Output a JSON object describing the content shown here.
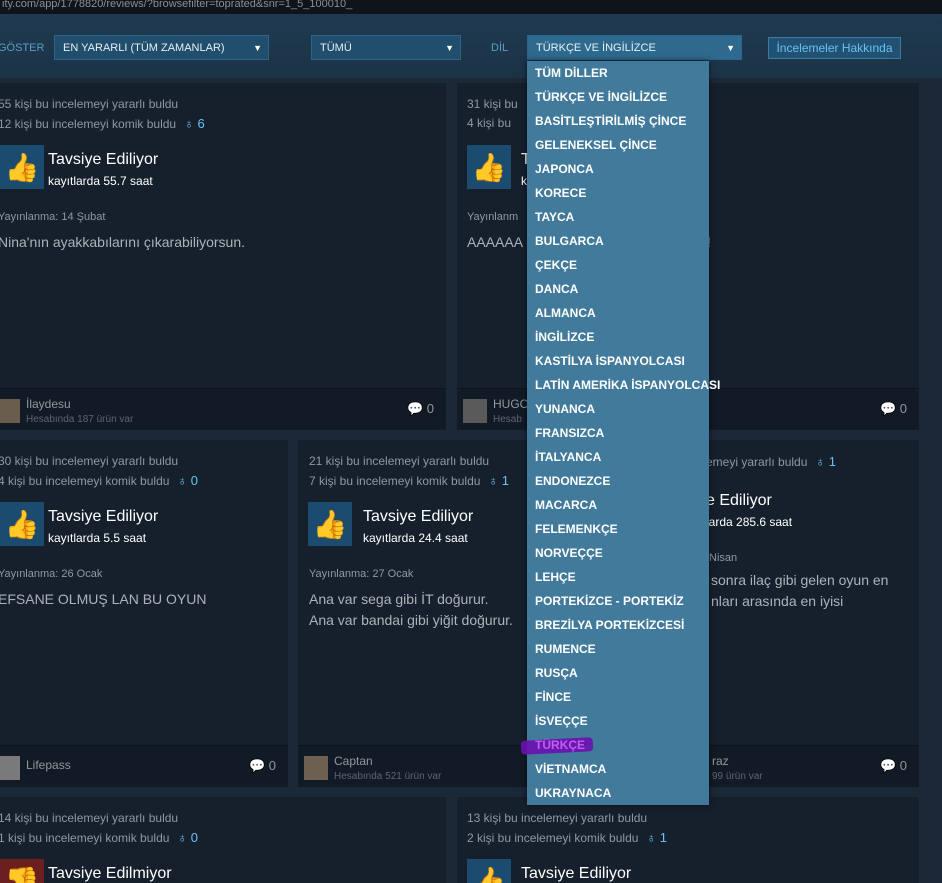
{
  "url": "ity.com/app/1778820/reviews/?browsefilter=toprated&snr=1_5_100010_",
  "filters": {
    "show_label": "GÖSTER",
    "sort_value": "EN YARARLI (TÜM ZAMANLAR)",
    "type_value": "TÜMÜ",
    "lang_label": "DİL",
    "lang_value": "TÜRKÇE VE İNGİLİZCE",
    "about_label": "İncelemeler Hakkında"
  },
  "languages": [
    "TÜM DİLLER",
    "TÜRKÇE VE İNGİLİZCE",
    "BASİTLEŞTİRİLMİŞ ÇİNCE",
    "GELENEKSEL ÇİNCE",
    "JAPONCA",
    "KORECE",
    "TAYCA",
    "BULGARCA",
    "ÇEKÇE",
    "DANCA",
    "ALMANCA",
    "İNGİLİZCE",
    "KASTİLYA İSPANYOLCASI",
    "LATİN AMERİKA İSPANYOLCASI",
    "YUNANCA",
    "FRANSIZCA",
    "İTALYANCA",
    "ENDONEZCE",
    "MACARCA",
    "FELEMENKÇE",
    "NORVEÇÇE",
    "LEHÇE",
    "PORTEKİZCE - PORTEKİZ",
    "BREZİLYA PORTEKİZCESİ",
    "RUMENCE",
    "RUSÇA",
    "FİNCE",
    "İSVEÇÇE",
    "TÜRKÇE",
    "VİETNAMCA",
    "UKRAYNACA"
  ],
  "highlighted_language_index": 28,
  "reviews": [
    {
      "helpful": "55 kişi bu incelemeyi yararlı buldu",
      "funny": "12 kişi bu incelemeyi komik buldu",
      "awards": "6",
      "title": "Tavsiye Ediliyor",
      "hours": "kayıtlarda 55.7 saat",
      "posted": "Yayınlanma: 14 Şubat",
      "text": "Nina'nın ayakkabılarını çıkarabiliyorsun.",
      "user": "İlaydesu",
      "owned": "Hesabında 187 ürün var",
      "comments": "0"
    },
    {
      "helpful": "31 kişi bu",
      "funny": "4 kişi bu",
      "title": "T",
      "hours": "ka",
      "posted": "Yayınlanm",
      "text": "AAAAAA",
      "text_tail": "!",
      "user": "HUGO",
      "owned": "Hesab",
      "comments": "0"
    },
    {
      "helpful": "30 kişi bu incelemeyi yararlı buldu",
      "funny": "4 kişi bu incelemeyi komik buldu",
      "awards": "0",
      "title": "Tavsiye Ediliyor",
      "hours": "kayıtlarda 5.5 saat",
      "posted": "Yayınlanma: 26 Ocak",
      "text": "EFSANE OLMUŞ LAN BU OYUN",
      "user": "Lifepass",
      "comments": "0"
    },
    {
      "helpful": "21 kişi bu incelemeyi yararlı buldu",
      "funny": "7 kişi bu incelemeyi komik buldu",
      "awards": "1",
      "title": "Tavsiye Ediliyor",
      "hours": "kayıtlarda 24.4 saat",
      "posted": "Yayınlanma: 27 Ocak",
      "text": "Ana var sega gibi İT doğurur.",
      "text2": "Ana var bandai gibi yiğit doğurur.",
      "user": "Captan",
      "owned": "Hesabında 521 ürün var",
      "comments": "0"
    },
    {
      "helpful": "emeyi yararlı buldu",
      "awards": "1",
      "title": "e Ediliyor",
      "hours": "larda 285.6 saat",
      "posted": "Nisan",
      "text": "sonra ilaç gibi gelen oyun en",
      "text2": "nları arasında en iyisi",
      "user": "raz",
      "owned": "99 ürün var",
      "comments": "0"
    },
    {
      "helpful": "14 kişi bu incelemeyi yararlı buldu",
      "funny": "1 kişi bu incelemeyi komik buldu",
      "awards": "0",
      "title": "Tavsiye Edilmiyor"
    },
    {
      "helpful": "13 kişi bu incelemeyi yararlı buldu",
      "funny": "2 kişi bu incelemeyi komik buldu",
      "awards": "1",
      "title": "Tavsiye Ediliyor"
    }
  ]
}
